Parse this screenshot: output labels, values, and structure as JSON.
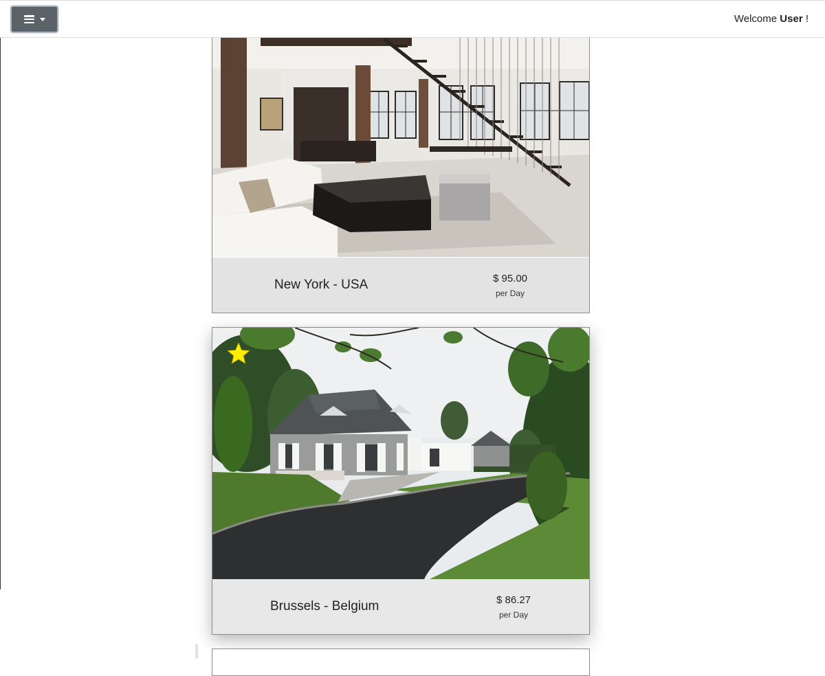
{
  "header": {
    "menu_button": {
      "icon": "hamburger-icon",
      "caret_icon": "caret-down-icon"
    },
    "welcome_prefix": "Welcome",
    "welcome_user": "User",
    "welcome_suffix": "!"
  },
  "listings": [
    {
      "location": "New York - USA",
      "price": "$ 95.00",
      "per": "per Day",
      "image": "loft-interior-photo",
      "favorite": false
    },
    {
      "location": "Brussels - Belgium",
      "price": "$ 86.27",
      "per": "per Day",
      "image": "house-exterior-photo",
      "favorite": true,
      "favorite_icon": "star-icon",
      "favorite_color": "#ffee00"
    },
    {
      "location": "",
      "image": "listing-photo",
      "favorite": false
    }
  ],
  "colors": {
    "menu_button_bg": "#5b6268",
    "card_footer_bg": "#e4e4e4",
    "star": "#ffee00"
  }
}
